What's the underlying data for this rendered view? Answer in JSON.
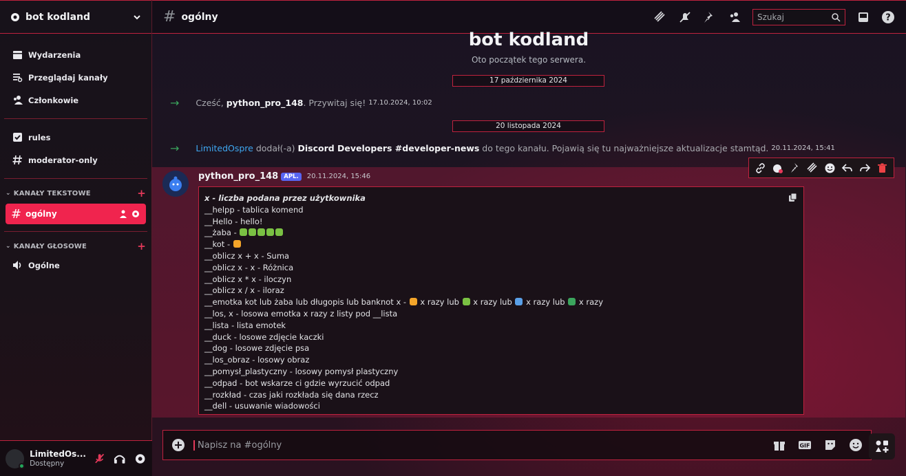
{
  "server": {
    "name": "bot kodland"
  },
  "sidebar": {
    "nav": [
      {
        "label": "Wydarzenia",
        "icon": "calendar-icon"
      },
      {
        "label": "Przeglądaj kanały",
        "icon": "browse-channels-icon"
      },
      {
        "label": "Członkowie",
        "icon": "members-icon"
      }
    ],
    "channels_top": [
      {
        "label": "rules",
        "icon": "rules-checkbox-icon"
      },
      {
        "label": "moderator-only",
        "icon": "hash-icon"
      }
    ],
    "text_category": "KANAŁY TEKSTOWE",
    "active_channel": "ogólny",
    "voice_category": "KANAŁY GŁOSOWE",
    "voice_channel": "Ogólne"
  },
  "user": {
    "name": "LimitedOs...",
    "status": "Dostępny"
  },
  "header": {
    "channel": "ogólny",
    "search_placeholder": "Szukaj"
  },
  "welcome": {
    "title": "bot kodland",
    "subtitle": "Oto początek tego serwera."
  },
  "dates": [
    "17 października 2024",
    "20 listopada 2024"
  ],
  "system_messages": [
    {
      "prefix": "Cześć,",
      "user": "python_pro_148",
      "suffix": ". Przywitaj się!",
      "time": "17.10.2024, 10:02"
    },
    {
      "user": "LimitedOspre",
      "middle": " dodał(-a) ",
      "channel": "Discord Developers #developer-news",
      "suffix": " do tego kanału. Pojawią się tu najważniejsze aktualizacje stamtąd.",
      "time": "20.11.2024, 15:41"
    }
  ],
  "message": {
    "author": "python_pro_148",
    "badge": "APL.",
    "time": "20.11.2024, 15:46",
    "lines": [
      "x - liczba podana przez użytkownika",
      "__helpp - tablica komend",
      "__Hello - hello!",
      "__żaba - ",
      "__kot - ",
      "__oblicz x + x - Suma",
      "__oblicz x - x - Różnica",
      "__oblicz x * x - iloczyn",
      "__oblicz x / x - iloraz",
      "__emotka kot lub żaba lub długopis lub banknot x - ",
      "__los, x - losowa emotka x razy z listy pod __lista",
      "__lista - lista emotek",
      "__duck - losowe zdjęcie kaczki",
      "__dog - losowe zdjęcie psa",
      "__los_obraz - losowy obraz",
      "__pomysł_plastyczny - losowy pomysł plastyczny",
      "__odpad - bot wskarze ci gdzie wyrzucić odpad",
      "__rozkład - czas jaki rozkłada się dana rzecz",
      "__dell - usuwanie wiadowości"
    ],
    "emotka_parts": [
      " x razy lub ",
      " x razy lub ",
      " x razy lub ",
      " x razy"
    ]
  },
  "composer": {
    "placeholder": "Napisz na #ogólny"
  }
}
